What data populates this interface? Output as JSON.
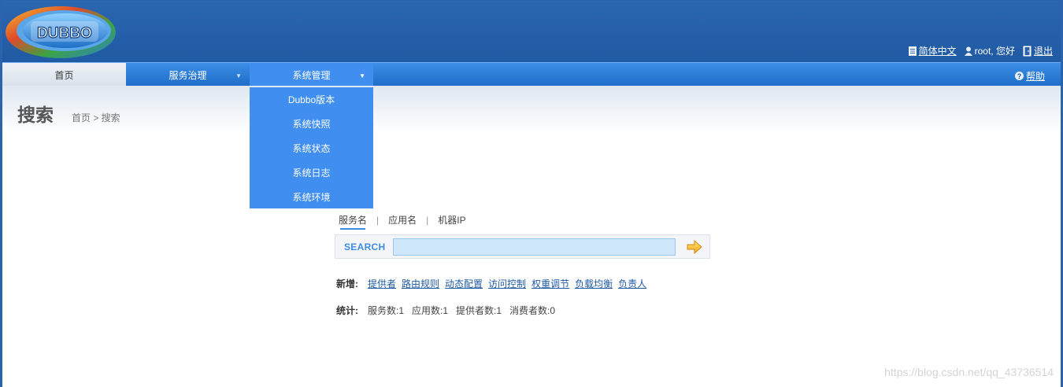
{
  "header": {
    "logo_text": "DUBBO",
    "language_link": "简体中文",
    "user_greeting": "root, 您好",
    "logout_link": "退出"
  },
  "nav": {
    "items": [
      {
        "label": "首页"
      },
      {
        "label": "服务治理"
      },
      {
        "label": "系统管理"
      }
    ],
    "help_label": "帮助"
  },
  "dropdown": {
    "items": [
      {
        "label": "Dubbo版本"
      },
      {
        "label": "系统快照"
      },
      {
        "label": "系统状态"
      },
      {
        "label": "系统日志"
      },
      {
        "label": "系统环境"
      }
    ]
  },
  "page": {
    "title": "搜索",
    "breadcrumb": "首页 > 搜索"
  },
  "search": {
    "tabs": [
      {
        "label": "服务名"
      },
      {
        "label": "应用名"
      },
      {
        "label": "机器IP"
      }
    ],
    "label": "SEARCH",
    "value": ""
  },
  "add_new": {
    "label": "新增:",
    "links": [
      {
        "label": "提供者"
      },
      {
        "label": "路由规则"
      },
      {
        "label": "动态配置"
      },
      {
        "label": "访问控制"
      },
      {
        "label": "权重调节"
      },
      {
        "label": "负载均衡"
      },
      {
        "label": "负责人"
      }
    ]
  },
  "stats": {
    "label": "统计:",
    "items": [
      {
        "text": "服务数:1"
      },
      {
        "text": "应用数:1"
      },
      {
        "text": "提供者数:1"
      },
      {
        "text": "消费者数:0"
      }
    ]
  },
  "watermark": "https://blog.csdn.net/qq_43736514",
  "colors": {
    "header_bg": "#2162ad",
    "nav_bg": "#2a7ad6",
    "dropdown_bg": "#3f8ef0",
    "link": "#1f5aa3"
  }
}
